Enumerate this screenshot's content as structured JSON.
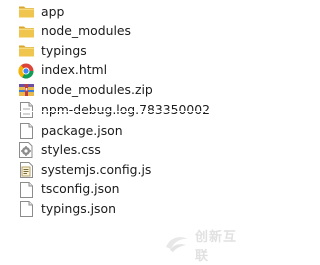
{
  "group_top": [
    {
      "name": "app",
      "icon": "folder-icon"
    },
    {
      "name": "node_modules",
      "icon": "folder-icon"
    },
    {
      "name": "typings",
      "icon": "folder-icon"
    },
    {
      "name": "index.html",
      "icon": "chrome-html-icon"
    },
    {
      "name": "node_modules.zip",
      "icon": "archive-icon"
    },
    {
      "name": "npm-debug.log.783350002",
      "icon": "text-document-icon"
    }
  ],
  "group_bottom": [
    {
      "name": "package.json",
      "icon": "blank-document-icon"
    },
    {
      "name": "styles.css",
      "icon": "css-gear-icon"
    },
    {
      "name": "systemjs.config.js",
      "icon": "script-icon"
    },
    {
      "name": "tsconfig.json",
      "icon": "blank-document-icon"
    },
    {
      "name": "typings.json",
      "icon": "blank-document-icon"
    }
  ],
  "watermark": {
    "text": "创新互联",
    "color": "#c9c9c9"
  },
  "colors": {
    "folder": "#f0c54e",
    "folder_dark": "#d9a62b",
    "text": "#1b1b1b"
  }
}
